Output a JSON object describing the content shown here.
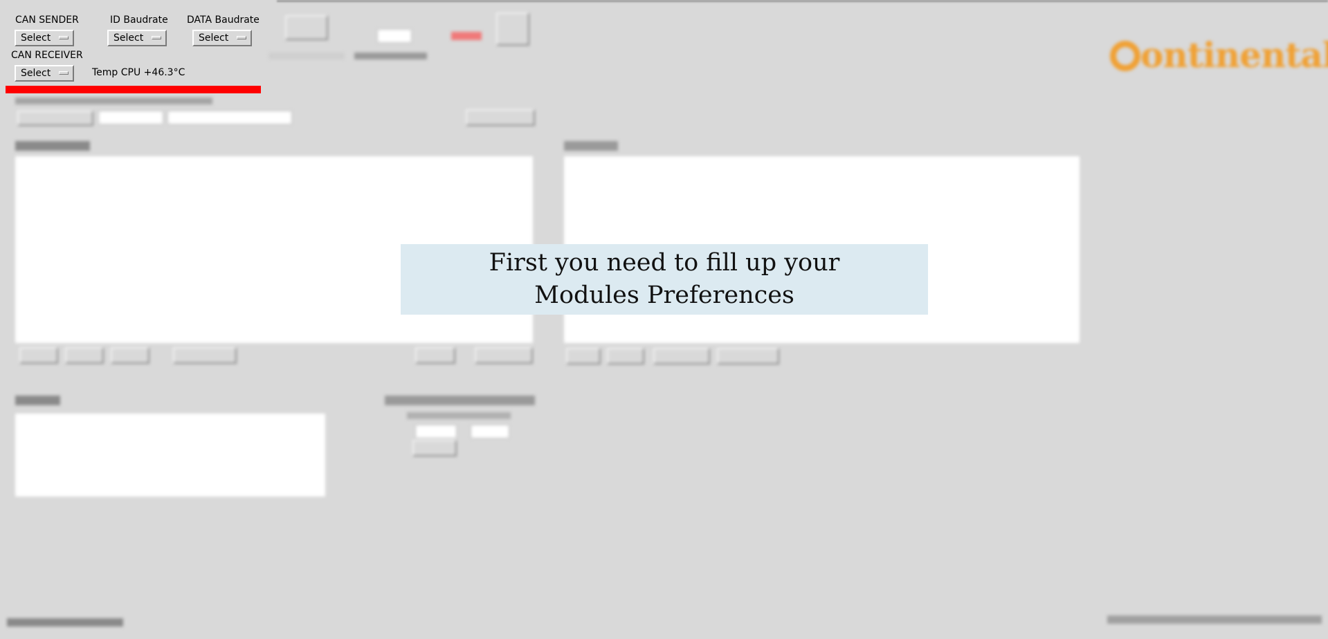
{
  "header": {
    "can_sender": {
      "label": "CAN SENDER",
      "value": "Select"
    },
    "id_baudrate": {
      "label": "ID Baudrate",
      "value": "Select"
    },
    "data_baudrate": {
      "label": "DATA Baudrate",
      "value": "Select"
    },
    "can_receiver": {
      "label": "CAN RECEIVER",
      "value": "Select"
    },
    "temp_cpu": "Temp CPU +46.3°C"
  },
  "colors": {
    "background": "#d9d9d9",
    "modal_background": "#dceaf1",
    "alert_bar": "#ff0000",
    "logo": "#f0a033"
  },
  "modal": {
    "line1": "First you need to fill up your",
    "line2": "Modules Preferences"
  },
  "logo": {
    "text": "ontinental"
  }
}
